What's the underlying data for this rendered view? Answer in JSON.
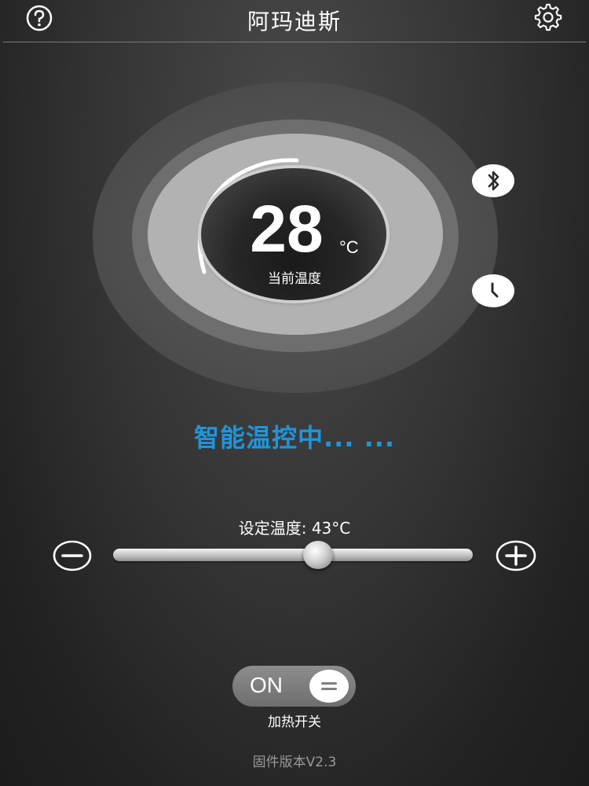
{
  "header": {
    "title": "阿玛迪斯",
    "help_icon": "help-circle-icon",
    "settings_icon": "gear-icon"
  },
  "dial": {
    "current_temp": "28",
    "unit": "°C",
    "label": "当前温度"
  },
  "side_buttons": {
    "bluetooth_icon": "bluetooth-icon",
    "clock_icon": "clock-icon"
  },
  "status": {
    "text": "智能温控中... ..."
  },
  "setpoint": {
    "label": "设定温度: 43°C",
    "minus_icon": "minus-circle-icon",
    "plus_icon": "plus-circle-icon",
    "slider_fraction": 0.57
  },
  "heater_switch": {
    "state": "ON",
    "label": "加热开关"
  },
  "footer": {
    "firmware": "固件版本V2.3"
  },
  "colors": {
    "status_blue": "#1e96dc",
    "background": "#353535",
    "toggle_track": "#7a7a7a"
  }
}
